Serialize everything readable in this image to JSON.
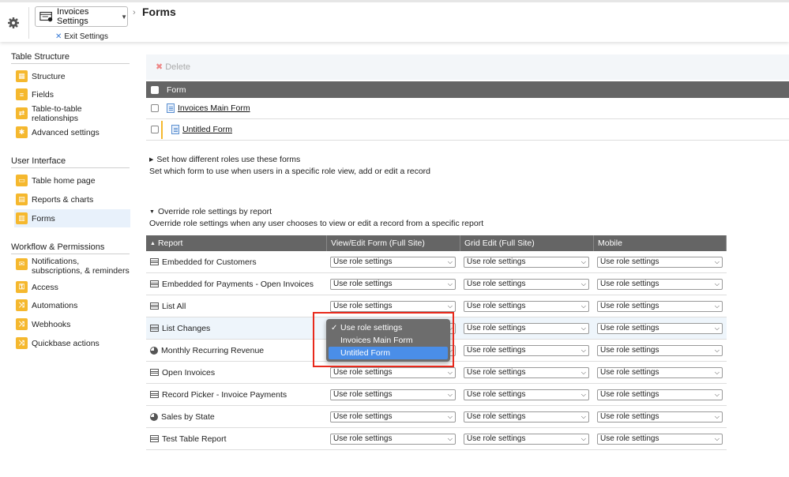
{
  "topbar": {
    "settings_label": "Invoices Settings",
    "exit_label": "Exit Settings",
    "page_title": "Forms"
  },
  "sidebar": {
    "sections": [
      {
        "title": "Table Structure"
      },
      {
        "title": "User Interface"
      },
      {
        "title": "Workflow & Permissions"
      }
    ],
    "items": [
      {
        "label": "Structure",
        "icon": "structure-icon"
      },
      {
        "label": "Fields",
        "icon": "fields-icon"
      },
      {
        "label": "Table-to-table relationships",
        "icon": "relationships-icon"
      },
      {
        "label": "Advanced settings",
        "icon": "gear-icon"
      },
      {
        "label": "Table home page",
        "icon": "home-page-icon"
      },
      {
        "label": "Reports & charts",
        "icon": "reports-icon"
      },
      {
        "label": "Forms",
        "icon": "forms-icon"
      },
      {
        "label": "Notifications, subscriptions, & reminders",
        "icon": "notifications-icon"
      },
      {
        "label": "Access",
        "icon": "access-icon"
      },
      {
        "label": "Automations",
        "icon": "automations-icon"
      },
      {
        "label": "Webhooks",
        "icon": "webhooks-icon"
      },
      {
        "label": "Quickbase actions",
        "icon": "actions-icon"
      }
    ],
    "active": "Forms"
  },
  "toolbar": {
    "delete_label": "Delete"
  },
  "forms_table": {
    "header": "Form",
    "rows": [
      "Invoices Main Form",
      "Untitled Form"
    ]
  },
  "roles_section": {
    "title": "Set how different roles use these forms",
    "subtitle": "Set which form to use when users in a specific role view, add or edit a record"
  },
  "override_section": {
    "title": "Override role settings by report",
    "subtitle": "Override role settings when any user chooses to view or edit a record from a specific report"
  },
  "report_table": {
    "columns": [
      "Report",
      "View/Edit Form (Full Site)",
      "Grid Edit (Full Site)",
      "Mobile"
    ],
    "default_value": "Use role settings",
    "rows": [
      {
        "name": "Embedded for Customers",
        "icon": "table-icon"
      },
      {
        "name": "Embedded for Payments - Open Invoices",
        "icon": "table-icon"
      },
      {
        "name": "List All",
        "icon": "table-icon"
      },
      {
        "name": "List Changes",
        "icon": "table-icon"
      },
      {
        "name": "Monthly Recurring Revenue",
        "icon": "pie-chart-icon"
      },
      {
        "name": "Open Invoices",
        "icon": "table-icon"
      },
      {
        "name": "Record Picker - Invoice Payments",
        "icon": "table-icon"
      },
      {
        "name": "Sales by State",
        "icon": "pie-chart-icon"
      },
      {
        "name": "Test Table Report",
        "icon": "table-icon"
      }
    ]
  },
  "dropdown": {
    "options": [
      "Use role settings",
      "Invoices Main Form",
      "Untitled Form"
    ],
    "checked": "Use role settings",
    "highlighted": "Untitled Form"
  },
  "colors": {
    "accent": "#f5b82e",
    "header_bg": "#656565",
    "highlight": "#4a8ee8",
    "annotation_red": "#e8291c"
  }
}
